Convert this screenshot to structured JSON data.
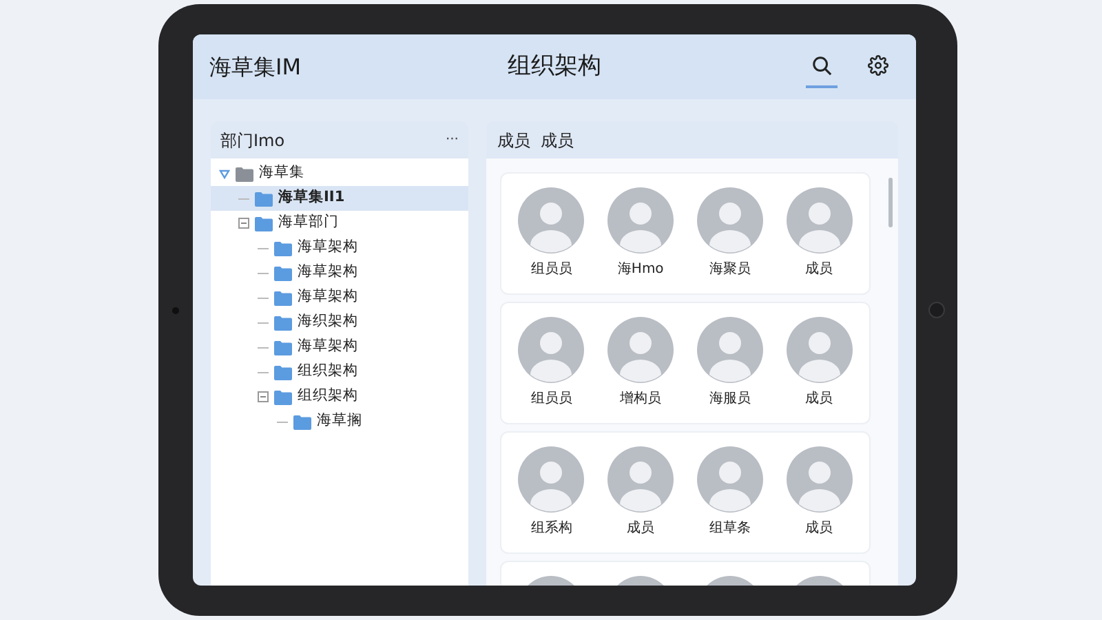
{
  "header": {
    "app_name": "海草集IM",
    "title": "组织架构",
    "actions": [
      {
        "kind": "search",
        "selected": true
      },
      {
        "kind": "settings",
        "selected": false
      }
    ]
  },
  "departments": {
    "title": "部门Imo",
    "more": "···",
    "tree": [
      {
        "label": "海草集",
        "kind": "root",
        "expanded": true,
        "selected": false,
        "children": [
          {
            "label": "海草集II1",
            "selected": true
          },
          {
            "label": "海草部门",
            "expanded": true,
            "selected": false,
            "children": [
              {
                "label": "海草架构",
                "selected": false
              },
              {
                "label": "海草架构",
                "selected": false
              },
              {
                "label": "海草架构",
                "selected": false
              },
              {
                "label": "海织架构",
                "selected": false
              },
              {
                "label": "海草架构",
                "selected": false
              },
              {
                "label": "组织架构",
                "selected": false
              },
              {
                "label": "组织架构",
                "expanded": true,
                "selected": false,
                "children": [
                  {
                    "label": "海草搁",
                    "selected": false
                  }
                ]
              }
            ]
          }
        ]
      }
    ]
  },
  "members_panel": {
    "title": "成员  成员",
    "rows": [
      {
        "members": [
          {
            "name": "组员员"
          },
          {
            "name": "海Hmo"
          },
          {
            "name": "海聚员"
          },
          {
            "name": "成员"
          }
        ]
      },
      {
        "members": [
          {
            "name": "组员员"
          },
          {
            "name": "增构员"
          },
          {
            "name": "海服员"
          },
          {
            "name": "成员"
          }
        ]
      },
      {
        "members": [
          {
            "name": "组系构"
          },
          {
            "name": "成员"
          },
          {
            "name": "组草条"
          },
          {
            "name": "成员"
          }
        ]
      },
      {
        "kind": "cut_off"
      }
    ]
  }
}
